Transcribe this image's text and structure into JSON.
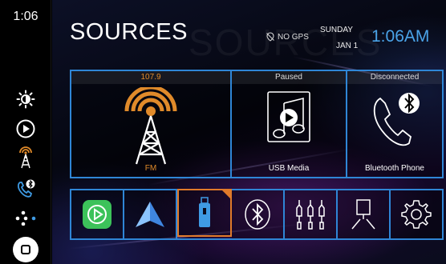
{
  "sidebar": {
    "time": "1:06",
    "icons": [
      "brightness-icon",
      "play-icon",
      "fm-tower-icon",
      "phone-bluetooth-icon",
      "apps-dots-icon",
      "home-icon"
    ]
  },
  "header": {
    "title": "SOURCES",
    "gps_status": "NO GPS",
    "day": "SUNDAY",
    "date": "JAN 1",
    "clock": "1:06AM"
  },
  "sources": [
    {
      "status": "107.9",
      "label": "FM",
      "icon": "fm-tower-icon",
      "status_color": "#e08a2a"
    },
    {
      "status": "Paused",
      "label": "USB Media",
      "icon": "usb-media-icon"
    },
    {
      "status": "Disconnected",
      "label": "Bluetooth Phone",
      "icon": "bluetooth-phone-icon"
    }
  ],
  "launcher": [
    "carplay-icon",
    "android-auto-icon",
    "usb-icon",
    "bluetooth-icon",
    "av-input-icon",
    "camera-icon",
    "settings-icon"
  ],
  "colors": {
    "accent": "#2f86d6",
    "active": "#e07a2a",
    "clock": "#4aa3e8",
    "carplay_green": "#3cc25a"
  }
}
